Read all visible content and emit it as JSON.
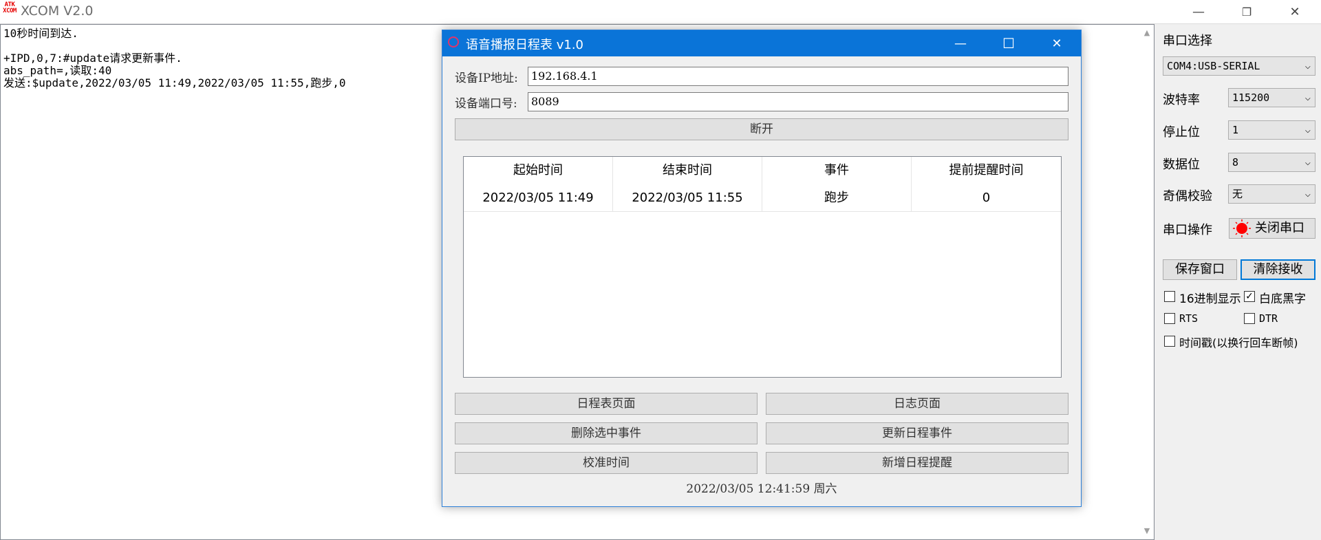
{
  "app": {
    "logo_top": "ATK",
    "logo_bottom": "XCOM",
    "title": "XCOM V2.0",
    "controls": {
      "minimize": "—",
      "restore": "❐",
      "close": "✕"
    }
  },
  "receive": {
    "text": "10秒时间到达.\n\n+IPD,0,7:#update请求更新事件.\nabs_path=,读取:40\n发送:$update,2022/03/05 11:49,2022/03/05 11:55,跑步,0",
    "scroll_up": "▲",
    "scroll_down": "▼"
  },
  "panel": {
    "port_label": "串口选择",
    "port_value": "COM4:USB-SERIAL",
    "baud_label": "波特率",
    "baud_value": "115200",
    "stop_label": "停止位",
    "stop_value": "1",
    "data_label": "数据位",
    "data_value": "8",
    "parity_label": "奇偶校验",
    "parity_value": "无",
    "op_label": "串口操作",
    "close_port": "关闭串口",
    "save_window": "保存窗口",
    "clear_recv": "清除接收",
    "hex_display": "16进制显示",
    "white_black": "白底黑字",
    "rts": "RTS",
    "dtr": "DTR",
    "timestamp": "时间戳(以换行回车断帧)",
    "status_color": "#ff0000"
  },
  "dialog": {
    "title": "语音播报日程表 v1.0",
    "controls": {
      "minimize": "—",
      "maximize": "☐",
      "close": "✕"
    },
    "ip_label": "设备IP地址:",
    "ip_value": "192.168.4.1",
    "port_label": "设备端口号:",
    "port_value": "8089",
    "disconnect": "断开",
    "table": {
      "headers": [
        "起始时间",
        "结束时间",
        "事件",
        "提前提醒时间"
      ],
      "rows": [
        [
          "2022/03/05 11:49",
          "2022/03/05 11:55",
          "跑步",
          "0"
        ]
      ]
    },
    "schedule_page": "日程表页面",
    "log_page": "日志页面",
    "delete_selected": "删除选中事件",
    "update_events": "更新日程事件",
    "calibrate_time": "校准时间",
    "add_reminder": "新增日程提醒",
    "status": "2022/03/05 12:41:59 周六"
  }
}
